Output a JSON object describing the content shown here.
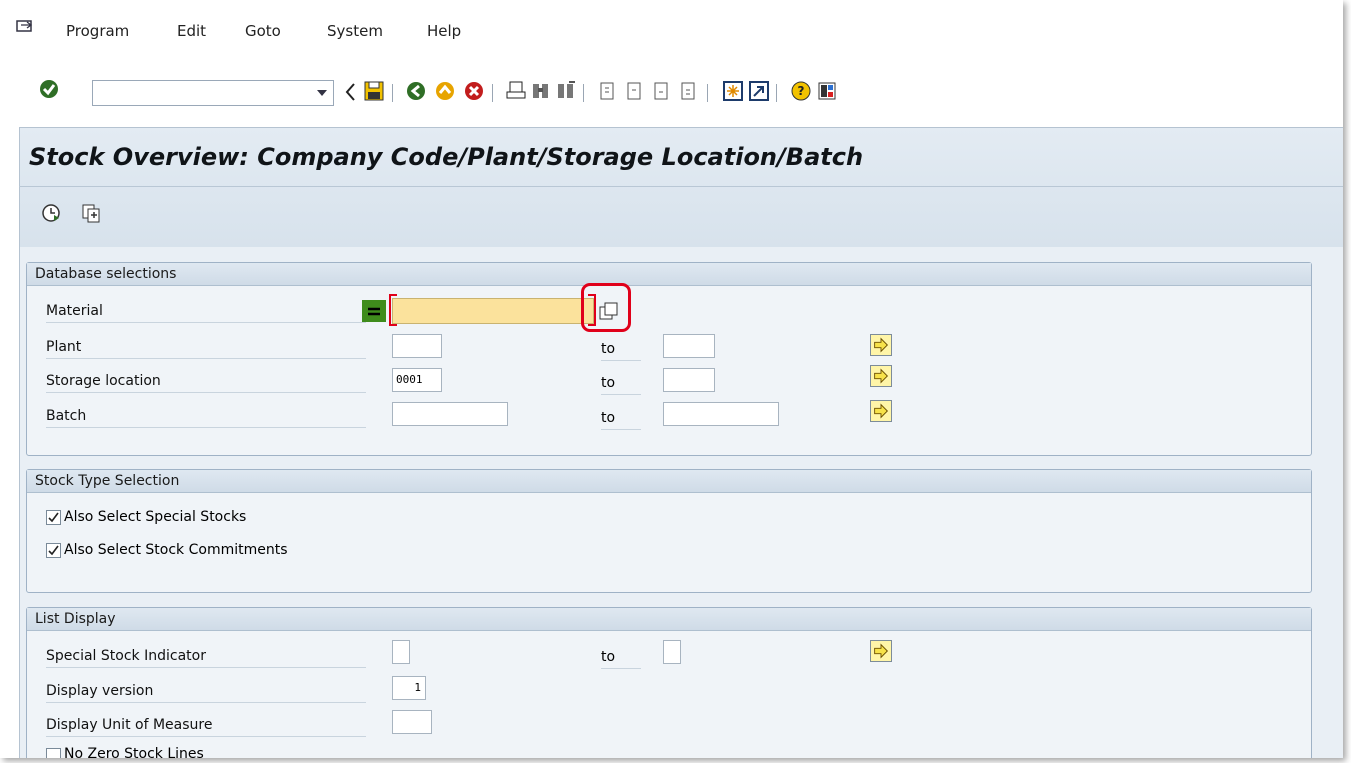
{
  "menu": {
    "items": [
      {
        "label": "Program"
      },
      {
        "label": "Edit"
      },
      {
        "label": "Goto"
      },
      {
        "label": "System"
      },
      {
        "label": "Help"
      }
    ]
  },
  "toolbar": {
    "command_value": "",
    "icons": [
      "enter-icon",
      "back-icon",
      "save-icon",
      "back-green-icon",
      "exit-icon",
      "cancel-icon",
      "print-icon",
      "find-icon",
      "find-next-icon",
      "first-page-icon",
      "prev-page-icon",
      "next-page-icon",
      "last-page-icon",
      "new-session-icon",
      "shortcut-icon",
      "help-icon",
      "layout-icon"
    ]
  },
  "title": "Stock Overview: Company Code/Plant/Storage Location/Batch",
  "app_toolbar": {
    "icons": [
      "execute-icon",
      "get-variant-icon"
    ]
  },
  "database_selections": {
    "header": "Database selections",
    "rows": [
      {
        "label": "Material",
        "from": "",
        "to_label": "",
        "to": ""
      },
      {
        "label": "Plant",
        "from": "",
        "to_label": "to",
        "to": ""
      },
      {
        "label": "Storage location",
        "from": "0001",
        "to_label": "to",
        "to": ""
      },
      {
        "label": "Batch",
        "from": "",
        "to_label": "to",
        "to": ""
      }
    ]
  },
  "stock_type_selection": {
    "header": "Stock Type Selection",
    "checkboxes": [
      {
        "label": "Also Select Special Stocks",
        "checked": true
      },
      {
        "label": "Also Select Stock Commitments",
        "checked": true
      }
    ]
  },
  "list_display": {
    "header": "List Display",
    "rows": [
      {
        "label": "Special Stock Indicator",
        "from": "",
        "to_label": "to",
        "to": ""
      },
      {
        "label": "Display version",
        "from": "1"
      },
      {
        "label": "Display Unit of Measure",
        "from": ""
      }
    ],
    "checkbox_label": "No Zero Stock Lines"
  },
  "colors": {
    "highlight": "#e0001a",
    "title_bg": "#dfe8f1",
    "material_field": "#fbe29c"
  }
}
